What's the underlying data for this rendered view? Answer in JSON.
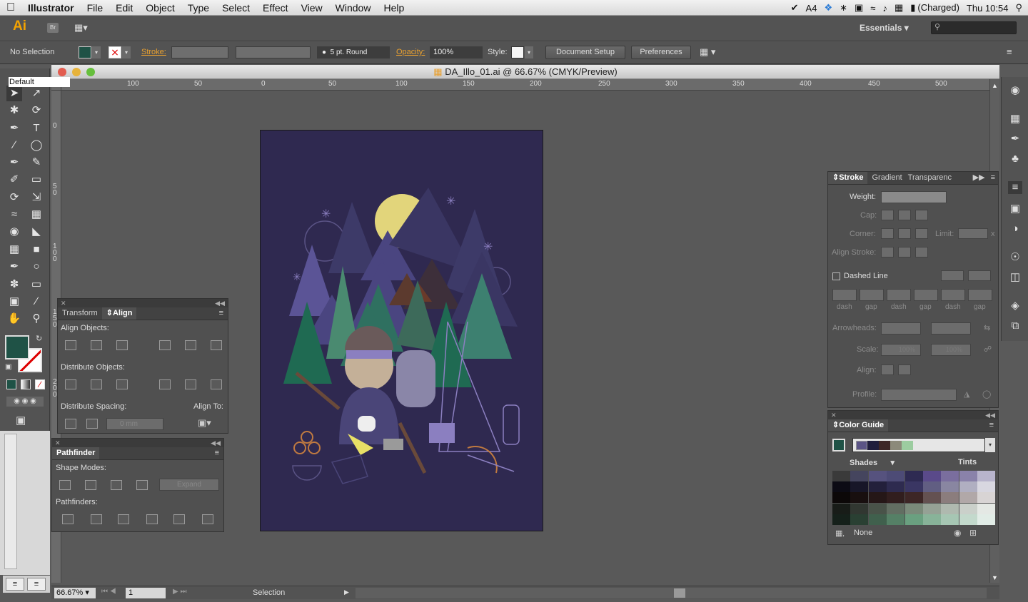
{
  "menubar": {
    "apple_icon": "apple-icon",
    "app_name": "Illustrator",
    "items": [
      "File",
      "Edit",
      "Object",
      "Type",
      "Select",
      "Effect",
      "View",
      "Window",
      "Help"
    ],
    "adobe_count": "4",
    "battery": "(Charged)",
    "clock": "Thu 10:54"
  },
  "appbar": {
    "logo": "Ai",
    "bridge": "Br",
    "workspace": "Essentials"
  },
  "control": {
    "selection": "No Selection",
    "stroke_label": "Stroke:",
    "brush": "5 pt. Round",
    "opacity_label": "Opacity:",
    "opacity_value": "100%",
    "style_label": "Style:",
    "doc_setup": "Document Setup",
    "preferences": "Preferences"
  },
  "toolbox": {
    "tooltip": "Default"
  },
  "document": {
    "title": "DA_Illo_01.ai @ 66.67% (CMYK/Preview)",
    "hruler": [
      "100",
      "50",
      "0",
      "50",
      "100",
      "150",
      "200",
      "250",
      "300",
      "350",
      "400",
      "450",
      "500"
    ],
    "vruler": [
      "0",
      "50",
      "100",
      "150",
      "200"
    ]
  },
  "status": {
    "zoom": "66.67%",
    "page": "1",
    "tool": "Selection"
  },
  "transform_panel": {
    "tab_transform": "Transform",
    "tab_align": "Align",
    "align_objects": "Align Objects:",
    "distribute_objects": "Distribute Objects:",
    "distribute_spacing": "Distribute Spacing:",
    "align_to": "Align To:",
    "spacing_value": "0 mm"
  },
  "pathfinder_panel": {
    "title": "Pathfinder",
    "shape_modes": "Shape Modes:",
    "expand": "Expand",
    "pathfinders": "Pathfinders:"
  },
  "stroke_panel": {
    "tab_stroke": "Stroke",
    "tab_gradient": "Gradient",
    "tab_transparency": "Transparenc",
    "weight": "Weight:",
    "cap": "Cap:",
    "corner": "Corner:",
    "limit": "Limit:",
    "limit_x": "x",
    "align_stroke": "Align Stroke:",
    "dashed_line": "Dashed Line",
    "dash_labels": [
      "dash",
      "gap",
      "dash",
      "gap",
      "dash",
      "gap"
    ],
    "arrowheads": "Arrowheads:",
    "scale": "Scale:",
    "scale_value": "100%",
    "align": "Align:",
    "profile": "Profile:"
  },
  "color_guide": {
    "title": "Color Guide",
    "shades": "Shades",
    "tints": "Tints",
    "none": "None",
    "harmony": [
      "#5b5486",
      "#1f1d3d",
      "#3d2626",
      "#8c8a7a",
      "#9ccca0"
    ],
    "grid_cols": [
      "#3a3a3a",
      "#45455e",
      "#56527e",
      "#4d4b76",
      "#2e2a52",
      "#5a4a8a",
      "#7a6e9e",
      "#8a82aa",
      "#b8b4cc"
    ]
  },
  "colors": {
    "fill": "#1f5246",
    "accent": "#e8a030",
    "artboard": "#2f2950"
  }
}
